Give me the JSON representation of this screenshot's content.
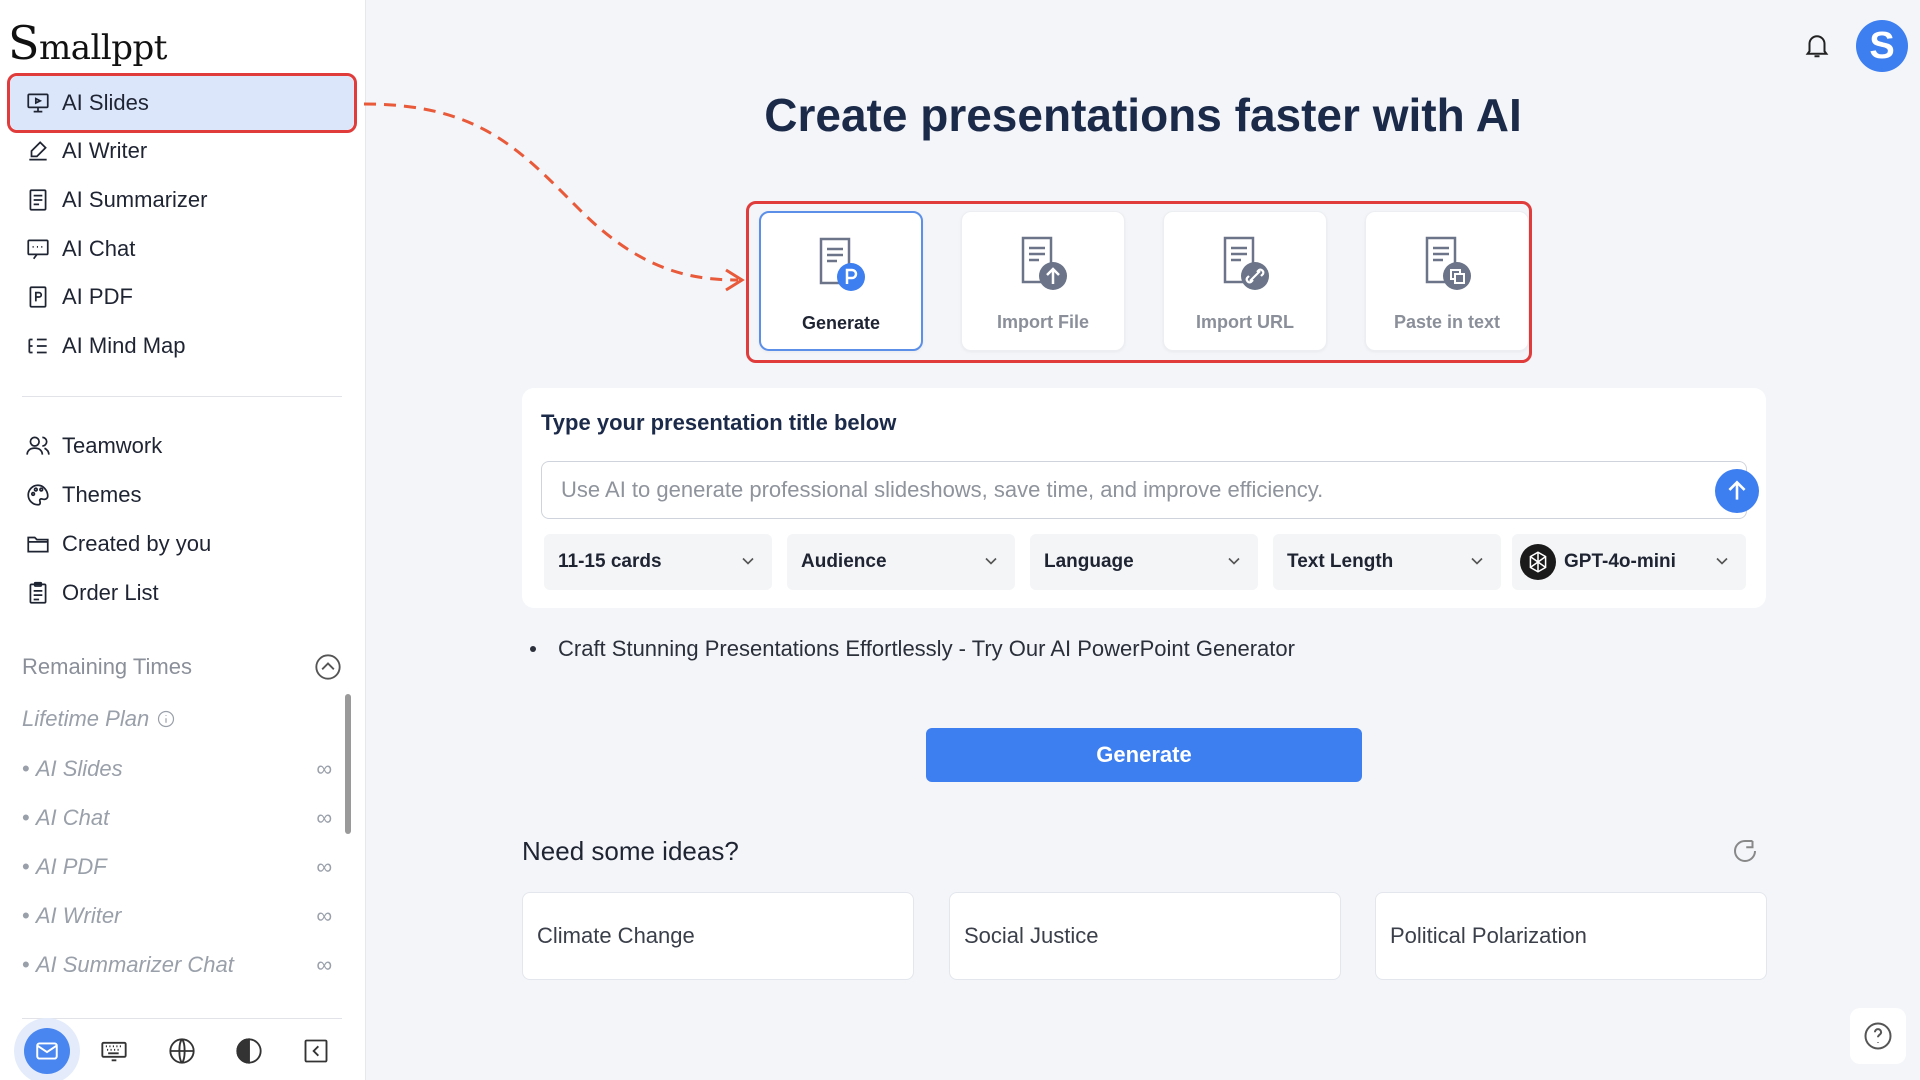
{
  "app": {
    "logo_first": "S",
    "logo_rest": "mallppt"
  },
  "sidebar": {
    "primary": [
      {
        "label": "AI Slides",
        "icon": "slides-icon",
        "active": true
      },
      {
        "label": "AI Writer",
        "icon": "writer-icon"
      },
      {
        "label": "AI Summarizer",
        "icon": "summarizer-icon"
      },
      {
        "label": "AI Chat",
        "icon": "chat-icon"
      },
      {
        "label": "AI PDF",
        "icon": "pdf-icon"
      },
      {
        "label": "AI Mind Map",
        "icon": "mind-map-icon"
      }
    ],
    "secondary": [
      {
        "label": "Teamwork",
        "icon": "team-icon"
      },
      {
        "label": "Themes",
        "icon": "palette-icon"
      },
      {
        "label": "Created by you",
        "icon": "folder-icon"
      },
      {
        "label": "Order List",
        "icon": "clipboard-icon"
      }
    ],
    "remaining_title": "Remaining Times",
    "plan": "Lifetime Plan",
    "quotas": [
      {
        "label": "AI Slides",
        "value": "∞"
      },
      {
        "label": "AI Chat",
        "value": "∞"
      },
      {
        "label": "AI PDF",
        "value": "∞"
      },
      {
        "label": "AI Writer",
        "value": "∞"
      },
      {
        "label": "AI Summarizer Chat",
        "value": "∞"
      }
    ],
    "bottom_icons": [
      "mail-icon",
      "keyboard-icon",
      "globe-icon",
      "contrast-icon",
      "collapse-icon"
    ]
  },
  "header": {
    "avatar_letter": "S"
  },
  "main": {
    "title": "Create presentations faster with AI",
    "modes": [
      {
        "label": "Generate",
        "icon": "generate-doc-icon",
        "selected": true
      },
      {
        "label": "Import File",
        "icon": "import-file-icon"
      },
      {
        "label": "Import URL",
        "icon": "import-url-icon"
      },
      {
        "label": "Paste in text",
        "icon": "paste-text-icon"
      }
    ],
    "panel_heading": "Type your presentation title below",
    "input_placeholder": "Use AI to generate professional slideshows, save time, and improve efficiency.",
    "selects": [
      {
        "label": "11-15 cards"
      },
      {
        "label": "Audience"
      },
      {
        "label": "Language"
      },
      {
        "label": "Text Length"
      },
      {
        "label": "GPT-4o-mini"
      }
    ],
    "bullet": "Craft Stunning Presentations Effortlessly - Try Our AI PowerPoint Generator",
    "generate_label": "Generate",
    "ideas_heading": "Need some ideas?",
    "ideas": [
      "Climate Change",
      "Social Justice",
      "Political Polarization"
    ]
  },
  "colors": {
    "accent": "#3d7ef0",
    "highlight_outline": "#e03c3c",
    "active_bg": "#dbe6fb"
  }
}
